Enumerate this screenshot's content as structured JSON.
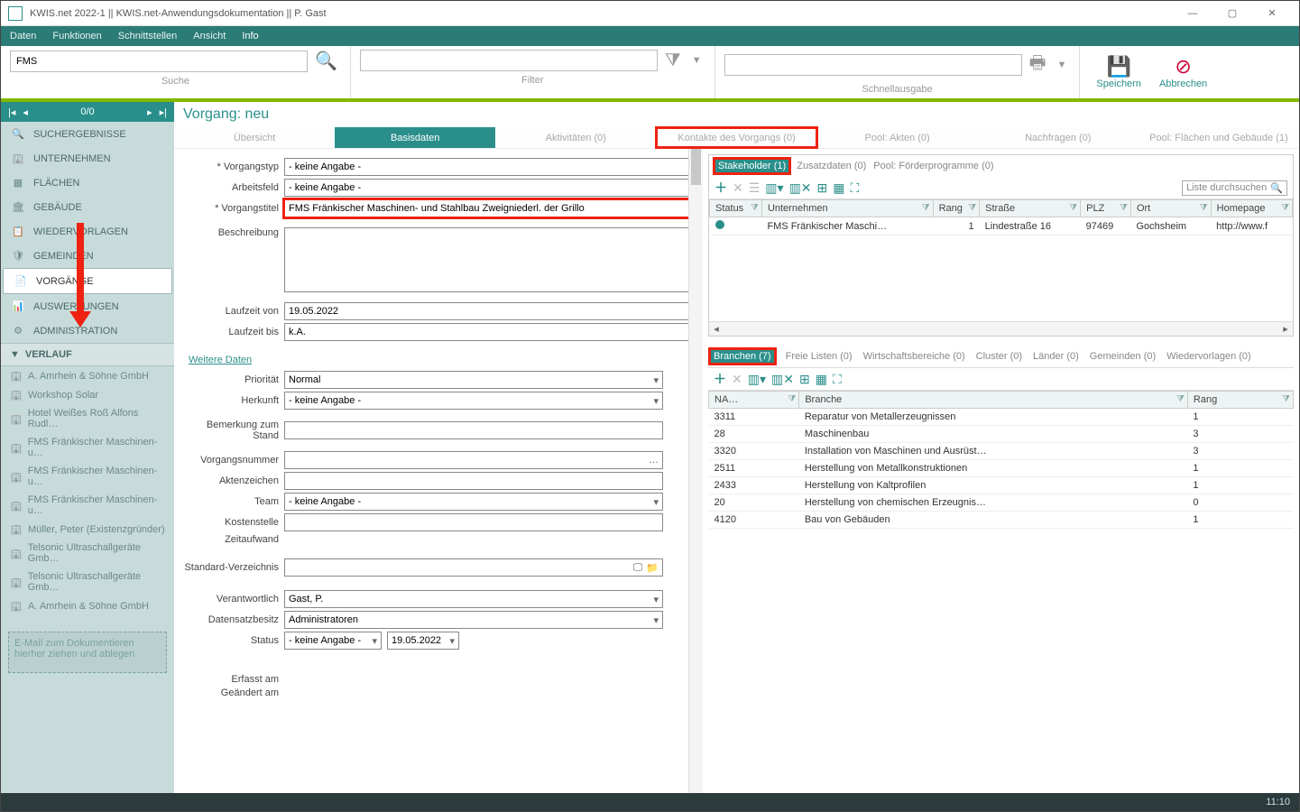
{
  "window": {
    "title": "KWIS.net 2022-1 || KWIS.net-Anwendungsdokumentation || P. Gast"
  },
  "menu": [
    "Daten",
    "Funktionen",
    "Schnittstellen",
    "Ansicht",
    "Info"
  ],
  "toolbar": {
    "search_value": "FMS",
    "search_label": "Suche",
    "filter_label": "Filter",
    "quick_label": "Schnellausgabe",
    "save": "Speichern",
    "cancel": "Abbrechen"
  },
  "nav": {
    "pager": "0/0",
    "items": [
      {
        "label": "SUCHERGEBNISSE",
        "icon": "🔍"
      },
      {
        "label": "UNTERNEHMEN",
        "icon": "🏢"
      },
      {
        "label": "FLÄCHEN",
        "icon": "▦"
      },
      {
        "label": "GEBÄUDE",
        "icon": "🏛"
      },
      {
        "label": "WIEDERVORLAGEN",
        "icon": "📋"
      },
      {
        "label": "GEMEINDEN",
        "icon": "🛡"
      },
      {
        "label": "VORGÄNGE",
        "icon": "📄"
      },
      {
        "label": "AUSWERTUNGEN",
        "icon": "📊"
      },
      {
        "label": "ADMINISTRATION",
        "icon": "⚙"
      }
    ],
    "active": 6,
    "verlauf_hdr": "VERLAUF",
    "history": [
      "A. Amrhein & Söhne GmbH",
      "Workshop Solar",
      "Hotel Weißes Roß Alfons Rudl…",
      "FMS Fränkischer Maschinen- u…",
      "FMS Fränkischer Maschinen- u…",
      "FMS Fränkischer Maschinen- u…",
      "Müller, Peter (Existenzgründer)",
      "Telsonic Ultraschallgeräte Gmb…",
      "Telsonic Ultraschallgeräte Gmb…",
      "A. Amrhein & Söhne GmbH"
    ],
    "dropzone": "E-Mail zum Dokumentieren hierher ziehen und ablegen"
  },
  "content": {
    "header": "Vorgang: neu",
    "tabs": [
      "Übersicht",
      "Basisdaten",
      "Aktivitäten (0)",
      "Kontakte des Vorgangs (0)",
      "Pool: Akten (0)",
      "Nachfragen (0)",
      "Pool: Flächen und Gebäude (1)"
    ],
    "active_tab": 1,
    "redbox_tab": 3
  },
  "form": {
    "labels": {
      "vorgangstyp": "* Vorgangstyp",
      "arbeitsfeld": "Arbeitsfeld",
      "vorgangstitel": "* Vorgangstitel",
      "beschreibung": "Beschreibung",
      "laufzeit_von": "Laufzeit von",
      "laufzeit_bis": "Laufzeit bis",
      "weitere": "Weitere Daten",
      "prioritaet": "Priorität",
      "herkunft": "Herkunft",
      "bemerkung": "Bemerkung zum Stand",
      "vnummer": "Vorgangsnummer",
      "aktenzeichen": "Aktenzeichen",
      "team": "Team",
      "kostenstelle": "Kostenstelle",
      "zeitaufwand": "Zeitaufwand",
      "stdverz": "Standard-Verzeichnis",
      "verantwortlich": "Verantwortlich",
      "dsbesitz": "Datensatzbesitz",
      "status": "Status",
      "erfasst": "Erfasst am",
      "geaendert": "Geändert am"
    },
    "values": {
      "keine_angabe": "- keine Angabe -",
      "vorgangstitel": "FMS Fränkischer Maschinen- und Stahlbau Zweigniederl. der Grillo",
      "laufzeit_von": "19.05.2022",
      "laufzeit_bis": "k.A.",
      "prioritaet": "Normal",
      "vnummer_btn": "…",
      "verantwortlich": "Gast, P.",
      "dsbesitz": "Administratoren",
      "status_date": "19.05.2022"
    }
  },
  "right_upper": {
    "tabs": [
      {
        "label": "Stakeholder (1)",
        "active": true,
        "redbox": true
      },
      {
        "label": "Zusatzdaten (0)"
      },
      {
        "label": "Pool: Förderprogramme (0)"
      }
    ],
    "search_ph": "Liste durchsuchen",
    "cols": [
      "Status",
      "Unternehmen",
      "Rang",
      "Straße",
      "PLZ",
      "Ort",
      "Homepage"
    ],
    "row": {
      "unternehmen": "FMS Fränkischer Maschi…",
      "rang": "1",
      "strasse": "Lindestraße 16",
      "plz": "97469",
      "ort": "Gochsheim",
      "homepage": "http://www.f"
    }
  },
  "right_lower": {
    "tabs": [
      {
        "label": "Branchen (7)",
        "active": true,
        "redbox": true
      },
      {
        "label": "Freie Listen (0)"
      },
      {
        "label": "Wirtschaftsbereiche (0)"
      },
      {
        "label": "Cluster (0)"
      },
      {
        "label": "Länder (0)"
      },
      {
        "label": "Gemeinden (0)"
      },
      {
        "label": "Wiedervorlagen (0)"
      }
    ],
    "cols": [
      "NA…",
      "Branche",
      "Rang"
    ],
    "rows": [
      {
        "na": "3311",
        "branche": "Reparatur von Metallerzeugnissen",
        "rang": "1"
      },
      {
        "na": "28",
        "branche": "Maschinenbau",
        "rang": "3"
      },
      {
        "na": "3320",
        "branche": "Installation von Maschinen und Ausrüst…",
        "rang": "3"
      },
      {
        "na": "2511",
        "branche": "Herstellung von Metallkonstruktionen",
        "rang": "1"
      },
      {
        "na": "2433",
        "branche": "Herstellung von Kaltprofilen",
        "rang": "1"
      },
      {
        "na": "20",
        "branche": "Herstellung von chemischen Erzeugnis…",
        "rang": "0"
      },
      {
        "na": "4120",
        "branche": "Bau von Gebäuden",
        "rang": "1"
      }
    ]
  },
  "statusbar": {
    "time": "11:10"
  }
}
